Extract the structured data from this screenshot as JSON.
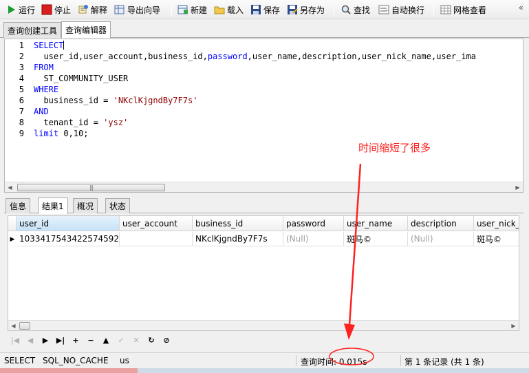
{
  "toolbar": {
    "run": "运行",
    "stop": "停止",
    "explain": "解释",
    "export_wizard": "导出向导",
    "new": "新建",
    "load": "载入",
    "save": "保存",
    "save_as": "另存为",
    "find": "查找",
    "word_wrap": "自动换行",
    "grid_view": "网格查看",
    "menu": "«"
  },
  "top_tabs": [
    "查询创建工具",
    "查询编辑器"
  ],
  "editor": {
    "line_numbers": [
      "1",
      "2",
      "3",
      "4",
      "5",
      "6",
      "7",
      "8",
      "9"
    ],
    "lines": {
      "l1_kw": "SELECT",
      "l2": "  user_id,user_account,business_id,",
      "l2_kw": "password",
      "l2_rest": ",user_name,description,user_nick_name,user_ima",
      "l3_kw": "FROM",
      "l4": "  ST_COMMUNITY_USER",
      "l5_kw": "WHERE",
      "l6": "  business_id = ",
      "l6_str": "'NKclKjgndBy7F7s'",
      "l7_kw": "AND",
      "l8": "  tenant_id = ",
      "l8_str": "'ysz'",
      "l9_kw": "limit",
      "l9_rest": " 0,10;"
    }
  },
  "annotation": "时间缩短了很多",
  "result_tabs": [
    "信息",
    "结果1",
    "概况",
    "状态"
  ],
  "grid": {
    "columns": [
      "user_id",
      "user_account",
      "business_id",
      "password",
      "user_name",
      "description",
      "user_nick_n"
    ],
    "row": [
      "1033417543422574592",
      "",
      "NKclKjgndBy7F7s",
      "(Null)",
      "斑马©",
      "(Null)",
      "斑马©"
    ]
  },
  "navbar": {
    "first": "|◀",
    "prev": "◀",
    "next": "▶",
    "last": "▶|",
    "add": "+",
    "delete": "−",
    "up": "▲",
    "check": "✓",
    "cancel": "✕",
    "refresh": "↻",
    "stop": "⊘"
  },
  "status": {
    "mode": "SELECT",
    "cache": "SQL_NO_CACHE",
    "us": "us",
    "query_time": "查询时间: 0.015s",
    "records": "第 1 条记录 (共 1 条)"
  }
}
